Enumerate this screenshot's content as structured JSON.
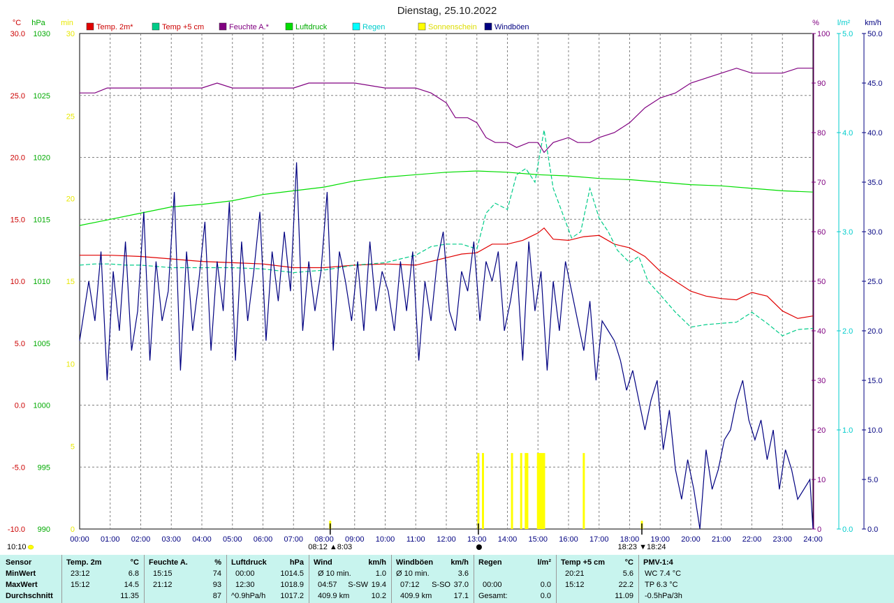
{
  "chart_data": {
    "type": "line",
    "title": "Dienstag, 25.10.2022",
    "x_ticks": [
      "00:00",
      "01:00",
      "02:00",
      "03:00",
      "04:00",
      "05:00",
      "06:00",
      "07:00",
      "08:00",
      "09:00",
      "10:00",
      "11:00",
      "12:00",
      "13:00",
      "14:00",
      "15:00",
      "16:00",
      "17:00",
      "18:00",
      "19:00",
      "20:00",
      "21:00",
      "22:00",
      "23:00",
      "24:00"
    ],
    "xlim": [
      0,
      24
    ],
    "axes": {
      "temp": {
        "unit": "°C",
        "ylim": [
          -10,
          30
        ],
        "ticks": [
          "-10.0",
          "-5.0",
          "0.0",
          "5.0",
          "10.0",
          "15.0",
          "20.0",
          "25.0",
          "30.0"
        ],
        "color": "#cc0000"
      },
      "pressure": {
        "unit": "hPa",
        "ylim": [
          990,
          1030
        ],
        "ticks": [
          "990",
          "995",
          "1000",
          "1005",
          "1010",
          "1015",
          "1020",
          "1025",
          "1030"
        ],
        "color": "#00aa00"
      },
      "sunshine": {
        "unit": "min",
        "ylim": [
          0,
          30
        ],
        "ticks": [
          "0",
          "5",
          "10",
          "15",
          "20",
          "25",
          "30"
        ],
        "color": "#e8e800"
      },
      "humidity": {
        "unit": "%",
        "ylim": [
          0,
          100
        ],
        "ticks": [
          "0",
          "10",
          "20",
          "30",
          "40",
          "50",
          "60",
          "70",
          "80",
          "90",
          "100"
        ],
        "color": "#800080"
      },
      "rain": {
        "unit": "l/m²",
        "ylim": [
          0,
          5
        ],
        "ticks": [
          "0.0",
          "1.0",
          "2.0",
          "3.0",
          "4.0",
          "5.0"
        ],
        "color": "#00cccc"
      },
      "wind": {
        "unit": "km/h",
        "ylim": [
          0,
          50
        ],
        "ticks": [
          "0.0",
          "5.0",
          "10.0",
          "15.0",
          "20.0",
          "25.0",
          "30.0",
          "35.0",
          "40.0",
          "45.0",
          "50.0"
        ],
        "color": "#000080"
      }
    },
    "legend": [
      {
        "name": "Temp. 2m*",
        "color": "#e00000",
        "text_color": "#cc0000"
      },
      {
        "name": "Temp +5 cm",
        "color": "#00cc88",
        "text_color": "#cc0000"
      },
      {
        "name": "Feuchte A.*",
        "color": "#800080",
        "text_color": "#800080"
      },
      {
        "name": "Luftdruck",
        "color": "#00dd00",
        "text_color": "#00aa00"
      },
      {
        "name": "Regen",
        "color": "#00ffff",
        "text_color": "#00cccc"
      },
      {
        "name": "Sonnenschein",
        "color": "#ffff00",
        "text_color": "#dddd00"
      },
      {
        "name": "Windböen",
        "color": "#000080",
        "text_color": "#000080"
      }
    ],
    "series": [
      {
        "name": "Temp. 2m*",
        "axis": "temp",
        "color": "#e00000",
        "x": [
          0,
          1,
          2,
          3,
          4,
          5,
          6,
          7,
          8,
          9,
          10,
          11,
          12,
          12.5,
          13,
          13.5,
          14,
          14.5,
          15,
          15.2,
          15.5,
          16,
          16.5,
          17,
          17.5,
          18,
          18.5,
          19,
          19.5,
          20,
          20.5,
          21,
          21.5,
          22,
          22.5,
          23,
          23.5,
          24
        ],
        "y": [
          12.1,
          12.1,
          12.0,
          11.8,
          11.6,
          11.5,
          11.4,
          11.1,
          11.1,
          11.3,
          11.4,
          11.3,
          11.9,
          12.2,
          12.3,
          13.0,
          13.0,
          13.3,
          13.9,
          14.3,
          13.4,
          13.3,
          13.6,
          13.7,
          13.0,
          12.7,
          12.0,
          10.8,
          10.0,
          9.2,
          8.8,
          8.6,
          8.5,
          9.1,
          8.8,
          7.6,
          7.0,
          7.2
        ]
      },
      {
        "name": "Temp +5 cm",
        "axis": "temp",
        "color": "#00cc88",
        "x": [
          0,
          0.5,
          1,
          1.5,
          2,
          2.5,
          3,
          4,
          5,
          6,
          7,
          8,
          9,
          10,
          10.5,
          11,
          11.5,
          12,
          12.5,
          13,
          13.3,
          13.6,
          14,
          14.3,
          14.6,
          14.9,
          15.2,
          15.5,
          15.8,
          16.1,
          16.4,
          16.7,
          17,
          17.3,
          17.6,
          18,
          18.3,
          18.6,
          19,
          19.5,
          20,
          20.5,
          21,
          21.5,
          22,
          22.5,
          23,
          23.5,
          24
        ],
        "y": [
          11.3,
          11.4,
          11.4,
          11.3,
          11.3,
          11.2,
          11.1,
          11.1,
          11.1,
          11.0,
          10.7,
          10.9,
          11.3,
          11.5,
          11.8,
          12.1,
          12.8,
          13.0,
          13.0,
          12.6,
          15.5,
          16.3,
          15.8,
          18.6,
          19.1,
          18.0,
          22.2,
          17.5,
          15.5,
          13.5,
          14.0,
          17.5,
          15.1,
          14.0,
          12.5,
          11.5,
          12.0,
          10.0,
          8.9,
          7.5,
          6.3,
          6.5,
          6.6,
          6.7,
          7.5,
          6.6,
          5.6,
          6.1,
          6.2
        ]
      },
      {
        "name": "Feuchte A.*",
        "axis": "humidity",
        "color": "#800080",
        "x": [
          0,
          0.5,
          0.9,
          1.5,
          2,
          3,
          4,
          4.5,
          5,
          6,
          7,
          7.5,
          8,
          9,
          10,
          10.5,
          11,
          11.5,
          12,
          12.3,
          12.7,
          13,
          13.3,
          13.6,
          14,
          14.3,
          14.7,
          15,
          15.2,
          15.5,
          16,
          16.3,
          16.7,
          17,
          17.5,
          18,
          18.5,
          19,
          19.5,
          20,
          20.5,
          21,
          21.5,
          22,
          22.5,
          23,
          23.5,
          24
        ],
        "y": [
          88,
          88,
          89,
          89,
          89,
          89,
          89,
          90,
          89,
          89,
          89,
          90,
          90,
          90,
          89,
          89,
          89,
          88,
          86,
          83,
          83,
          82,
          79,
          78,
          78,
          77,
          78,
          78,
          76,
          78,
          79,
          78,
          78,
          79,
          80,
          82,
          85,
          87,
          88,
          90,
          91,
          92,
          93,
          92,
          92,
          92,
          93,
          93
        ]
      },
      {
        "name": "Luftdruck",
        "axis": "pressure",
        "color": "#00dd00",
        "x": [
          0,
          1,
          2,
          3,
          4,
          5,
          6,
          7,
          8,
          9,
          10,
          11,
          12,
          13,
          14,
          15,
          16,
          17,
          18,
          19,
          20,
          21,
          22,
          23,
          24
        ],
        "y": [
          1014.5,
          1015.0,
          1015.5,
          1016.0,
          1016.2,
          1016.5,
          1017.0,
          1017.3,
          1017.6,
          1018.1,
          1018.4,
          1018.6,
          1018.8,
          1018.9,
          1018.8,
          1018.6,
          1018.5,
          1018.3,
          1018.2,
          1018.0,
          1017.8,
          1017.7,
          1017.5,
          1017.3,
          1017.2
        ]
      },
      {
        "name": "Windböen",
        "axis": "wind",
        "color": "#000080",
        "x": [
          0,
          0.3,
          0.5,
          0.7,
          0.9,
          1.1,
          1.3,
          1.5,
          1.7,
          1.9,
          2.1,
          2.3,
          2.5,
          2.7,
          2.9,
          3.1,
          3.3,
          3.5,
          3.7,
          3.9,
          4.1,
          4.3,
          4.5,
          4.7,
          4.9,
          5.1,
          5.3,
          5.5,
          5.7,
          5.9,
          6.1,
          6.3,
          6.5,
          6.7,
          6.9,
          7.1,
          7.3,
          7.5,
          7.7,
          7.9,
          8.1,
          8.3,
          8.5,
          8.7,
          8.9,
          9.1,
          9.3,
          9.5,
          9.7,
          9.9,
          10.1,
          10.3,
          10.5,
          10.7,
          10.9,
          11.1,
          11.3,
          11.5,
          11.7,
          11.9,
          12.1,
          12.3,
          12.5,
          12.7,
          12.9,
          13.1,
          13.3,
          13.5,
          13.7,
          13.9,
          14.1,
          14.3,
          14.5,
          14.7,
          14.9,
          15.1,
          15.3,
          15.5,
          15.7,
          15.9,
          16.1,
          16.3,
          16.5,
          16.7,
          16.9,
          17.1,
          17.3,
          17.5,
          17.7,
          17.9,
          18.1,
          18.3,
          18.5,
          18.7,
          18.9,
          19.1,
          19.3,
          19.5,
          19.7,
          19.9,
          20.1,
          20.3,
          20.5,
          20.7,
          20.9,
          21.1,
          21.3,
          21.5,
          21.7,
          21.9,
          22.1,
          22.3,
          22.5,
          22.7,
          22.9,
          23.1,
          23.3,
          23.5,
          23.7,
          23.9,
          24
        ],
        "y": [
          19,
          25,
          21,
          28,
          15,
          26,
          20,
          29,
          18,
          22,
          32,
          17,
          27,
          21,
          24,
          34,
          16,
          28,
          20,
          25,
          31,
          18,
          27,
          22,
          33,
          17,
          29,
          21,
          26,
          32,
          19,
          28,
          23,
          30,
          24,
          37,
          20,
          27,
          22,
          26,
          34,
          18,
          28,
          25,
          21,
          27,
          20,
          29,
          22,
          26,
          24,
          20,
          27,
          22,
          28,
          17,
          25,
          21,
          27,
          30,
          22,
          20,
          26,
          24,
          29,
          21,
          27,
          25,
          28,
          20,
          23,
          27,
          17,
          29,
          22,
          26,
          16,
          25,
          20,
          27,
          24,
          21,
          18,
          23,
          15,
          21,
          20,
          19,
          17,
          14,
          16,
          13,
          10,
          13,
          15,
          8,
          12,
          6,
          3,
          7,
          4,
          0,
          8,
          4,
          6,
          9,
          10,
          13,
          15,
          11,
          9,
          11,
          7,
          10,
          4,
          8,
          6,
          3,
          4,
          5,
          0
        ]
      },
      {
        "name": "Sonnenschein",
        "axis": "sunshine",
        "color": "#ffff00",
        "type": "bar",
        "x": [
          8.2,
          13.05,
          13.2,
          14.15,
          14.45,
          14.6,
          14.65,
          15.0,
          15.05,
          15.1,
          15.15,
          15.2,
          16.5,
          18.4
        ],
        "y": [
          0.5,
          4.6,
          4.6,
          4.6,
          4.6,
          4.6,
          4.6,
          4.6,
          4.6,
          4.6,
          4.6,
          4.6,
          4.6,
          0.5
        ]
      }
    ],
    "markers": {
      "sunrise": {
        "label": "08:12 ▲8:03",
        "x": 8.2
      },
      "noon": {
        "x": 13.05
      },
      "sunset": {
        "label": "18:23 ▼18:24",
        "x": 18.4
      },
      "now": {
        "label": "10:10"
      }
    }
  },
  "stats": {
    "sensor": {
      "header": "Sensor",
      "rows": [
        "MinWert",
        "MaxWert",
        "Durchschnitt"
      ]
    },
    "temp2m": {
      "header": "Temp. 2m",
      "unit": "°C",
      "rows": [
        [
          "23:12",
          "6.8"
        ],
        [
          "15:12",
          "14.5"
        ],
        [
          "",
          "11.35"
        ]
      ]
    },
    "feuchte": {
      "header": "Feuchte A.",
      "unit": "%",
      "rows": [
        [
          "15:15",
          "74"
        ],
        [
          "21:12",
          "93"
        ],
        [
          "",
          "87"
        ]
      ]
    },
    "luftdruck": {
      "header": "Luftdruck",
      "unit": "hPa",
      "rows": [
        [
          "00:00",
          "1014.5"
        ],
        [
          "12:30",
          "1018.9"
        ],
        [
          "^0.9hPa/h",
          "1017.2"
        ]
      ]
    },
    "wind": {
      "header": "Wind",
      "unit": "km/h",
      "rows": [
        [
          "Ø 10 min.",
          "",
          "1.0"
        ],
        [
          "04:57",
          "S-SW",
          "19.4"
        ],
        [
          "409.9 km",
          "",
          "10.2"
        ]
      ]
    },
    "windboeen": {
      "header": "Windböen",
      "unit": "km/h",
      "rows": [
        [
          "Ø 10 min.",
          "",
          "3.6"
        ],
        [
          "07:12",
          "S-SO",
          "37.0"
        ],
        [
          "409.9 km",
          "",
          "17.1"
        ]
      ]
    },
    "regen": {
      "header": "Regen",
      "unit": "l/m²",
      "rows": [
        [
          "",
          "",
          ""
        ],
        [
          "00:00",
          "",
          "0.0"
        ],
        [
          "Gesamt:",
          "",
          "0.0"
        ]
      ],
      "row0": "0.0"
    },
    "temp5cm": {
      "header": "Temp +5 cm",
      "unit": "°C",
      "rows": [
        [
          "20:21",
          "5.6"
        ],
        [
          "15:12",
          "22.2"
        ],
        [
          "",
          "11.09"
        ]
      ]
    },
    "pmv": {
      "header": "PMV-1:4",
      "rows": [
        "WC 7.4 °C",
        "TP 6.3 °C",
        "-0.5hPa/3h"
      ]
    }
  }
}
